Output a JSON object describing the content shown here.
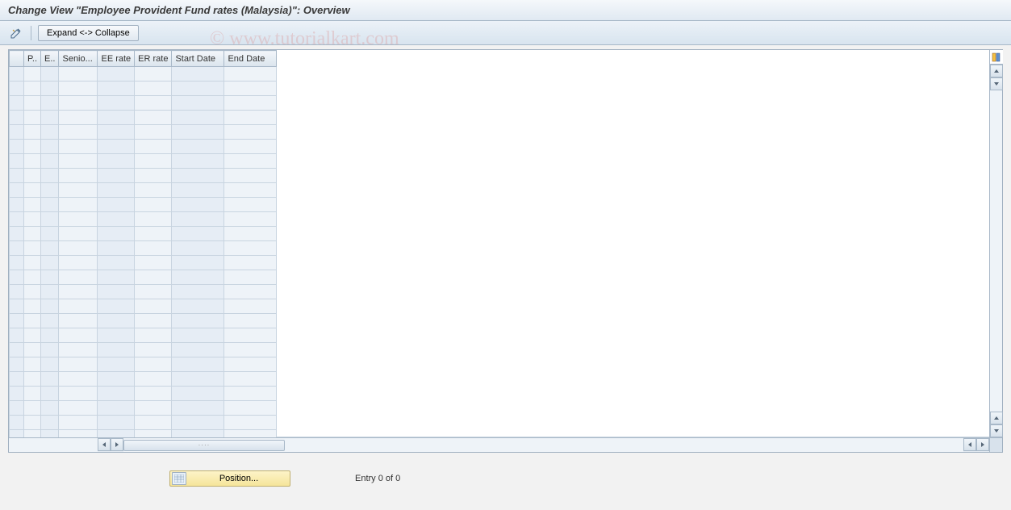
{
  "title": "Change View \"Employee Provident Fund rates (Malaysia)\": Overview",
  "toolbar": {
    "expand_collapse": "Expand <-> Collapse"
  },
  "table": {
    "columns": {
      "p": "P..",
      "e": "E..",
      "senio": "Senio...",
      "ee_rate": "EE rate",
      "er_rate": "ER rate",
      "start_date": "Start Date",
      "end_date": "End Date"
    },
    "row_count": 26
  },
  "footer": {
    "position_label": "Position...",
    "entry_text": "Entry 0 of 0"
  },
  "watermark": "© www.tutorialkart.com"
}
